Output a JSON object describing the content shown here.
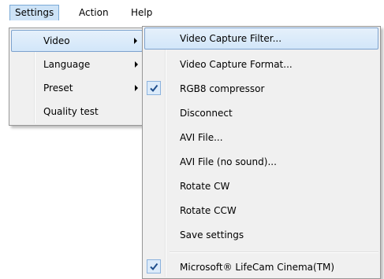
{
  "menubar": {
    "items": [
      {
        "label": "Settings"
      },
      {
        "label": "Action"
      },
      {
        "label": "Help"
      }
    ]
  },
  "settings_menu": {
    "items": [
      {
        "label": "Video",
        "has_submenu": true,
        "highlighted": true
      },
      {
        "label": "Language",
        "has_submenu": true
      },
      {
        "label": "Preset",
        "has_submenu": true
      },
      {
        "label": "Quality test",
        "has_submenu": false
      }
    ]
  },
  "video_submenu": {
    "items": [
      {
        "label": "Video Capture Filter...",
        "highlighted": true,
        "checked": false
      },
      {
        "label": "Video Capture Format...",
        "checked": false
      },
      {
        "label": "RGB8 compressor",
        "checked": true
      },
      {
        "label": "Disconnect",
        "checked": false
      },
      {
        "label": "AVI File...",
        "checked": false
      },
      {
        "label": "AVI File (no sound)...",
        "checked": false
      },
      {
        "label": "Rotate CW",
        "checked": false
      },
      {
        "label": "Rotate CCW",
        "checked": false
      },
      {
        "label": "Save settings",
        "checked": false
      },
      {
        "label": "Microsoft® LifeCam Cinema(TM)",
        "checked": true
      }
    ]
  },
  "colors": {
    "highlight": "#d2e6f9",
    "highlight_border": "#7da2ce",
    "menu_bg": "#f0f0f0",
    "check_bg": "#dcebfa"
  }
}
